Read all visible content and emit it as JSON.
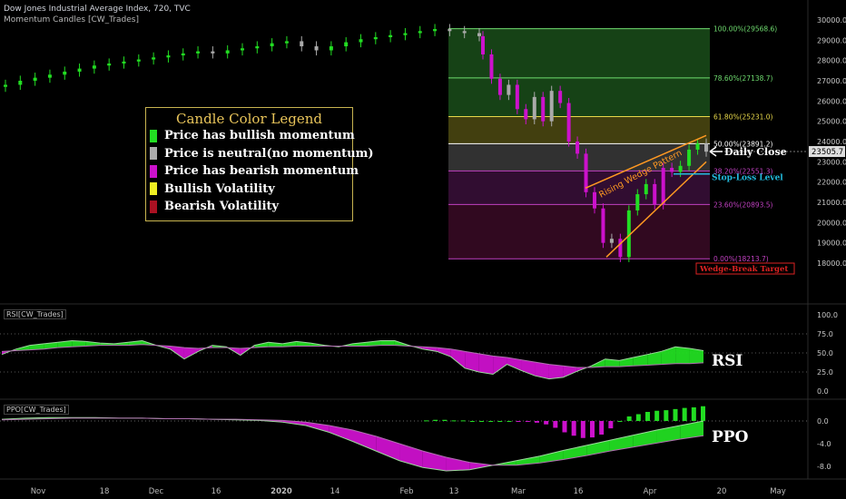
{
  "header": {
    "title": "Dow Jones Industrial Average Index, 720, TVC",
    "indicator": "Momentum Candles [CW_Trades]"
  },
  "legend": {
    "title": "Candle Color Legend",
    "items": [
      {
        "label": "Price has bullish momentum",
        "color": "#22dd22"
      },
      {
        "label": "Price is neutral(no momentum)",
        "color": "#aaaaaa"
      },
      {
        "label": "Price has bearish momentum",
        "color": "#cc11cc"
      },
      {
        "label": "Bullish Volatility",
        "color": "#eeee22"
      },
      {
        "label": "Bearish Volatility",
        "color": "#aa1122"
      }
    ]
  },
  "annotations": {
    "daily_close": "Daily Close",
    "stop_loss": "Stop-Loss Level",
    "wedge_target": "Wedge-Break Target",
    "wedge_pattern": "Rising Wedge Pattern",
    "rsi_big": "RSI",
    "ppo_big": "PPO"
  },
  "panes": {
    "rsi_label": "RSI[CW_Trades]",
    "ppo_label": "PPO[CW_Trades]"
  },
  "colors": {
    "bullish": "#22dd22",
    "neutral": "#aaaaaa",
    "bearish": "#cc11cc",
    "fib_green": "#1a4d1a",
    "fib_yellow": "#4d4a12",
    "fib_grey": "#3a3a3a",
    "fib_purple": "#3a0f3a",
    "fib_maroon": "#3a0a26",
    "wedge": "#ff9922",
    "stop_loss": "#22bbdd",
    "target": "#dd2222"
  },
  "chart_data": [
    {
      "type": "candlestick",
      "title": "Dow Jones Industrial Average Index, 720, TVC",
      "ylim": [
        17800,
        30300
      ],
      "y_ticks": [
        "30000.0",
        "29000.0",
        "28000.0",
        "27000.0",
        "26000.0",
        "25000.0",
        "24000.0",
        "23000.0",
        "22000.0",
        "21000.0",
        "20000.0",
        "19000.0",
        "18000.0"
      ],
      "current_price": "23505.7",
      "x_ticks": [
        "Nov",
        "18",
        "Dec",
        "16",
        "2020",
        "14",
        "Feb",
        "13",
        "Mar",
        "16",
        "Apr",
        "20",
        "May"
      ],
      "series": [
        {
          "name": "Momentum Candles",
          "close": [
            26800,
            27000,
            27150,
            27300,
            27450,
            27600,
            27750,
            27850,
            27950,
            28050,
            28150,
            28250,
            28350,
            28450,
            28350,
            28500,
            28600,
            28700,
            28850,
            28950,
            28700,
            28500,
            28700,
            28900,
            29050,
            29150,
            29250,
            29350,
            29450,
            29550,
            29450,
            29350,
            29200,
            28300,
            27100,
            26300,
            26800,
            25600,
            25100,
            26200,
            25000,
            26500,
            25900,
            24000,
            23400,
            21500,
            20700,
            19000,
            19200,
            18300,
            20600,
            21400,
            21900,
            20900,
            22700,
            22500,
            22800,
            23600,
            23900,
            23500
          ]
        }
      ],
      "fib_levels": [
        {
          "ratio": "100.00%",
          "value": 29568.6,
          "label": "100.00%(29568.6)",
          "color": "#6fdc6f"
        },
        {
          "ratio": "78.60%",
          "value": 27138.7,
          "label": "78.60%(27138.7)",
          "color": "#6fdc6f"
        },
        {
          "ratio": "61.80%",
          "value": 25231.0,
          "label": "61.80%(25231.0)",
          "color": "#e8d84a"
        },
        {
          "ratio": "50.00%",
          "value": 23891.2,
          "label": "50.00%(23891.2)",
          "color": "#ffffff"
        },
        {
          "ratio": "38.20%",
          "value": 22551.3,
          "label": "38.20%(22551.3)",
          "color": "#c040c0"
        },
        {
          "ratio": "23.60%",
          "value": 20893.5,
          "label": "23.60%(20893.5)",
          "color": "#c040c0"
        },
        {
          "ratio": "0.00%",
          "value": 18213.7,
          "label": "0.00%(18213.7)",
          "color": "#c040c0"
        }
      ],
      "stop_loss": 22400,
      "wedge_target": 18300
    },
    {
      "type": "area",
      "title": "RSI[CW_Trades]",
      "ylim": [
        -5,
        105
      ],
      "y_ticks": [
        "100.0",
        "75.0",
        "50.0",
        "25.0",
        "0.0"
      ],
      "series": [
        {
          "name": "RSI",
          "values": [
            48,
            55,
            60,
            62,
            64,
            66,
            65,
            63,
            62,
            64,
            66,
            60,
            55,
            42,
            52,
            60,
            58,
            47,
            60,
            64,
            62,
            65,
            63,
            60,
            58,
            62,
            64,
            66,
            66,
            60,
            55,
            52,
            45,
            30,
            25,
            22,
            35,
            27,
            20,
            16,
            18,
            26,
            33,
            42,
            40,
            44,
            48,
            52,
            58,
            56,
            53
          ]
        },
        {
          "name": "Signal",
          "values": [
            52,
            53,
            54,
            55,
            57,
            58,
            59,
            60,
            60,
            60,
            61,
            60,
            59,
            57,
            56,
            57,
            57,
            56,
            57,
            58,
            58,
            59,
            59,
            59,
            59,
            59,
            59,
            60,
            60,
            59,
            58,
            57,
            55,
            52,
            49,
            46,
            44,
            41,
            38,
            35,
            33,
            31,
            31,
            32,
            32,
            33,
            34,
            35,
            36,
            36,
            37
          ]
        }
      ]
    },
    {
      "type": "area",
      "title": "PPO[CW_Trades]",
      "ylim": [
        -10.5,
        2
      ],
      "y_ticks": [
        "0.0",
        "-4.0",
        "-8.0"
      ],
      "series": [
        {
          "name": "PPO",
          "values": [
            0.3,
            0.5,
            0.6,
            0.6,
            0.6,
            0.5,
            0.5,
            0.4,
            0.4,
            0.3,
            0.2,
            0.1,
            -0.2,
            -0.8,
            -2.0,
            -3.6,
            -5.3,
            -7.0,
            -8.2,
            -8.8,
            -8.6,
            -7.8,
            -7.0,
            -6.2,
            -5.2,
            -4.3,
            -3.4,
            -2.5,
            -1.6,
            -0.8,
            0.0
          ]
        },
        {
          "name": "Signal",
          "values": [
            0.2,
            0.3,
            0.4,
            0.5,
            0.5,
            0.5,
            0.5,
            0.4,
            0.4,
            0.3,
            0.3,
            0.2,
            0.1,
            -0.2,
            -0.8,
            -1.6,
            -2.7,
            -4.0,
            -5.3,
            -6.4,
            -7.3,
            -7.8,
            -7.8,
            -7.4,
            -6.8,
            -6.1,
            -5.3,
            -4.6,
            -3.9,
            -3.2,
            -2.6
          ]
        },
        {
          "name": "Histogram",
          "values": [
            0.1,
            0.2,
            0.2,
            0.1,
            0.1,
            0.0,
            0.0,
            0.0,
            0.0,
            0.0,
            -0.1,
            -0.1,
            -0.3,
            -0.6,
            -1.2,
            -2.0,
            -2.6,
            -3.0,
            -2.9,
            -2.4,
            -1.3,
            0.0,
            0.8,
            1.2,
            1.6,
            1.8,
            1.9,
            2.1,
            2.3,
            2.4,
            2.6
          ]
        }
      ]
    }
  ]
}
